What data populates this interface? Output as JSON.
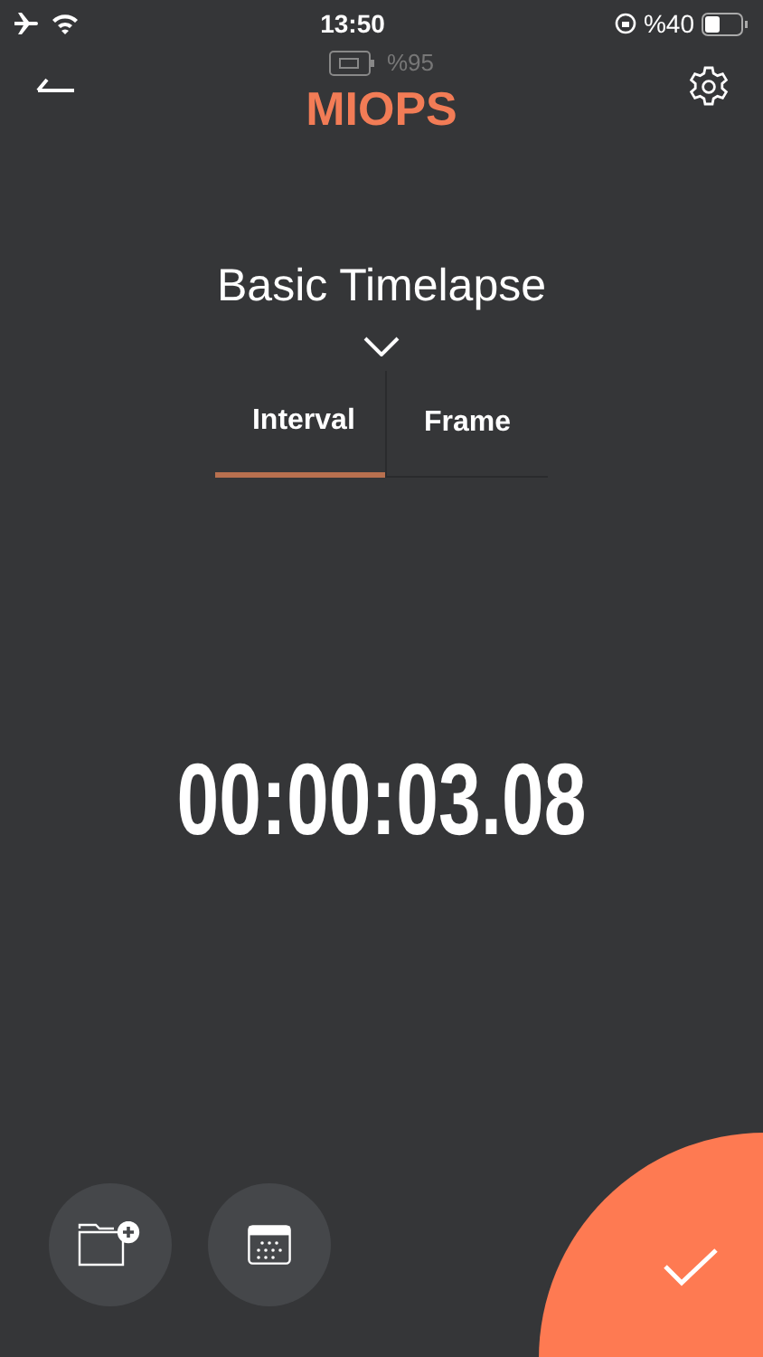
{
  "status_bar": {
    "time": "13:50",
    "battery": "%40"
  },
  "header": {
    "device_battery": "%95",
    "logo": "MIOPS"
  },
  "mode": {
    "title": "Basic Timelapse"
  },
  "tabs": [
    {
      "label": "Interval",
      "selected": true
    },
    {
      "label": "Frame",
      "selected": false
    }
  ],
  "timer": "00:00:03.08"
}
